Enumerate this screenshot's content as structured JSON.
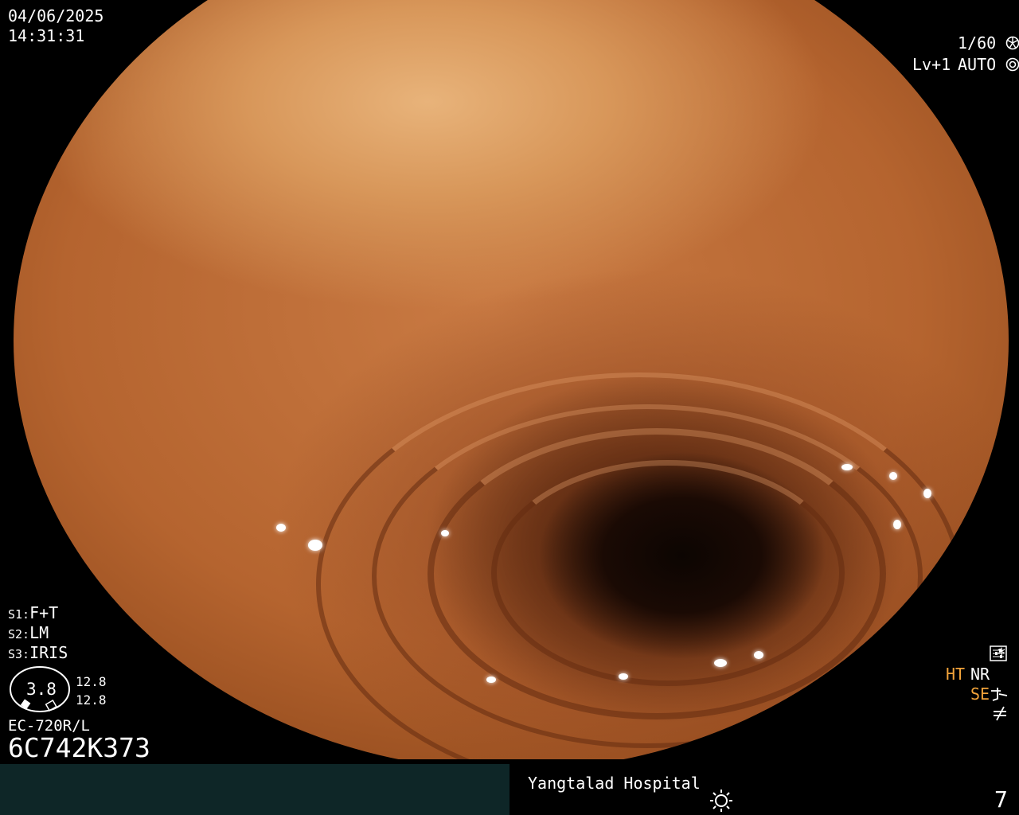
{
  "overlay": {
    "date": "04/06/2025",
    "time": "14:31:31",
    "shutter": "1/60",
    "level": "Lv+1",
    "auto": "AUTO"
  },
  "settings": {
    "s1_key": "S1:",
    "s1_val": "F+T",
    "s2_key": "S2:",
    "s2_val": "LM",
    "s3_key": "S3:",
    "s3_val": "IRIS"
  },
  "scope": {
    "diameter": "3.8",
    "value_top": "12.8",
    "value_bottom": "12.8",
    "model": "EC-720R/L",
    "serial": "6C742K373"
  },
  "right_status": {
    "asterisk": "*",
    "ht": "HT",
    "nr": "NR",
    "se": "SE"
  },
  "footer": {
    "hospital": "Yangtalad Hospital",
    "image_number": "7"
  },
  "colors": {
    "status_accent": "#f2a33a",
    "footer_left": "#0e2627"
  }
}
